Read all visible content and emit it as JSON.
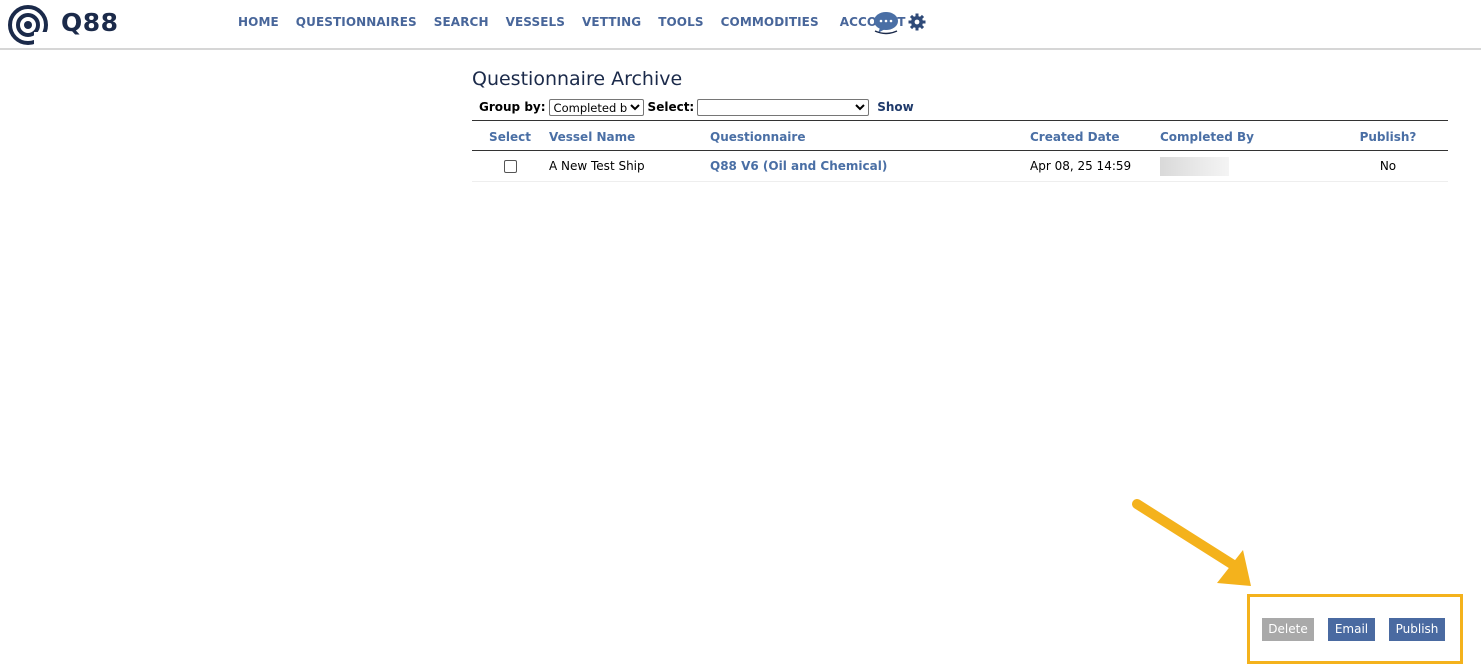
{
  "header": {
    "logo_text": "Q88",
    "nav": [
      "HOME",
      "QUESTIONNAIRES",
      "SEARCH",
      "VESSELS",
      "VETTING",
      "TOOLS",
      "COMMODITIES",
      "ACCOUNT"
    ],
    "icons": [
      "chat-icon",
      "gear-icon"
    ]
  },
  "page": {
    "title": "Questionnaire Archive",
    "group_by_label": "Group by:",
    "group_by_value": "Completed by",
    "select_label": "Select:",
    "select_value": "",
    "show_label": "Show"
  },
  "table": {
    "columns": [
      "Select",
      "Vessel Name",
      "Questionnaire",
      "Created Date",
      "Completed By",
      "Publish?"
    ],
    "rows": [
      {
        "selected": false,
        "vessel": "A New Test Ship",
        "questionnaire": "Q88 V6 (Oil and Chemical)",
        "created": "Apr 08, 25 14:59",
        "completed_by": "",
        "publish": "No"
      }
    ]
  },
  "actions": {
    "delete": "Delete",
    "email": "Email",
    "publish": "Publish"
  },
  "colors": {
    "nav": "#48669a",
    "accent": "#4a6aa1",
    "highlight": "#f4b21c",
    "disabled": "#a9a9a9"
  }
}
